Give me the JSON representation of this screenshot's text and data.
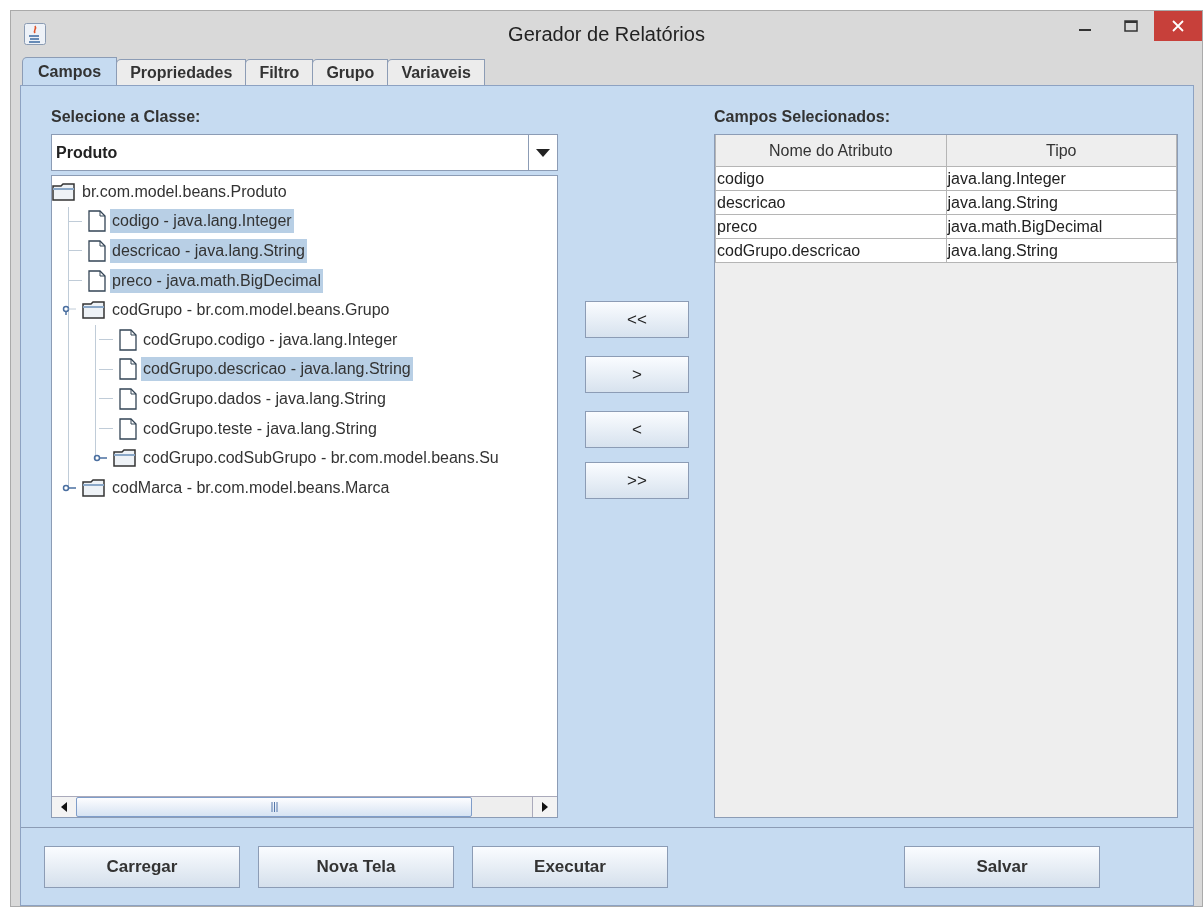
{
  "window": {
    "title": "Gerador de Relatórios"
  },
  "tabs": [
    {
      "label": "Campos",
      "selected": true
    },
    {
      "label": "Propriedades",
      "selected": false
    },
    {
      "label": "Filtro",
      "selected": false
    },
    {
      "label": "Grupo",
      "selected": false
    },
    {
      "label": "Variaveis",
      "selected": false
    }
  ],
  "class_label": "Selecione a Classe:",
  "class_select": {
    "value": "Produto"
  },
  "tree": [
    {
      "kind": "folder",
      "label": "br.com.model.beans.Produto",
      "selected": false,
      "children": [
        {
          "kind": "leaf",
          "label": "codigo - java.lang.Integer",
          "selected": true
        },
        {
          "kind": "leaf",
          "label": "descricao - java.lang.String",
          "selected": true
        },
        {
          "kind": "leaf",
          "label": "preco - java.math.BigDecimal",
          "selected": true
        },
        {
          "kind": "folder",
          "label": "codGrupo - br.com.model.beans.Grupo",
          "selected": false,
          "expanded": true,
          "children": [
            {
              "kind": "leaf",
              "label": "codGrupo.codigo - java.lang.Integer",
              "selected": false
            },
            {
              "kind": "leaf",
              "label": "codGrupo.descricao - java.lang.String",
              "selected": true
            },
            {
              "kind": "leaf",
              "label": "codGrupo.dados - java.lang.String",
              "selected": false
            },
            {
              "kind": "leaf",
              "label": "codGrupo.teste - java.lang.String",
              "selected": false
            },
            {
              "kind": "folder",
              "label": "codGrupo.codSubGrupo - br.com.model.beans.Su",
              "selected": false,
              "expanded": false
            }
          ]
        },
        {
          "kind": "folder",
          "label": "codMarca - br.com.model.beans.Marca",
          "selected": false,
          "expanded": false
        }
      ]
    }
  ],
  "move_buttons": [
    "<<",
    ">",
    "<",
    ">>"
  ],
  "selected_label": "Campos Selecionados:",
  "table": {
    "columns": [
      "Nome do Atributo",
      "Tipo"
    ],
    "rows": [
      [
        "codigo",
        "java.lang.Integer"
      ],
      [
        "descricao",
        "java.lang.String"
      ],
      [
        "preco",
        "java.math.BigDecimal"
      ],
      [
        "codGrupo.descricao",
        "java.lang.String"
      ]
    ]
  },
  "buttons": [
    "Carregar",
    "Nova Tela",
    "Executar",
    "Salvar"
  ]
}
